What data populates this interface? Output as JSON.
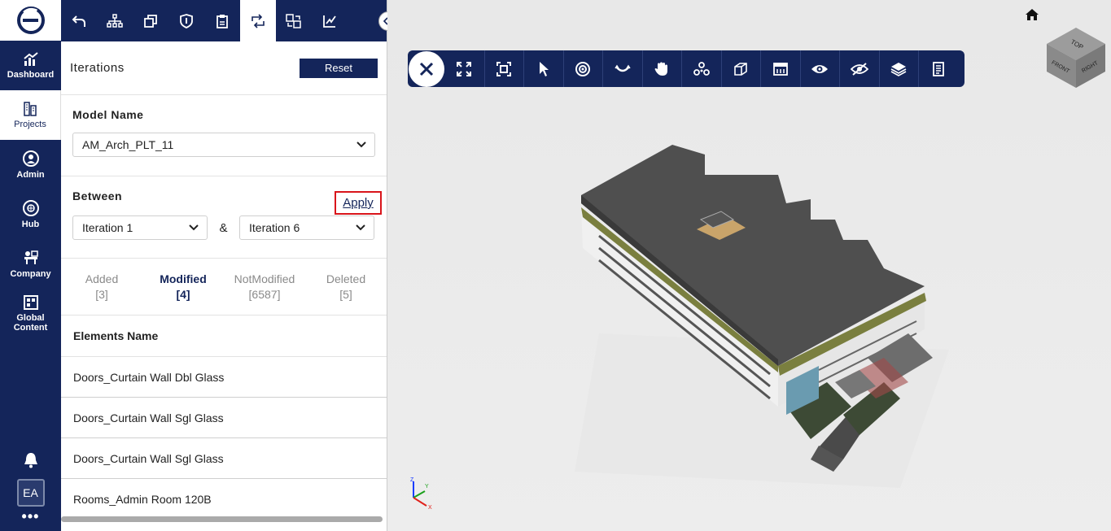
{
  "nav": {
    "items": [
      {
        "label": "Dashboard"
      },
      {
        "label": "Projects"
      },
      {
        "label": "Admin"
      },
      {
        "label": "Hub"
      },
      {
        "label": "Company"
      },
      {
        "label": "Global Content"
      }
    ],
    "avatar_initials": "EA",
    "more": "•••"
  },
  "panel": {
    "title": "Iterations",
    "reset_label": "Reset",
    "model_name_label": "Model Name",
    "model_name_value": "AM_Arch_PLT_11",
    "between_label": "Between",
    "apply_label": "Apply",
    "iteration_from": "Iteration 1",
    "ampersand": "&",
    "iteration_to": "Iteration 6",
    "stats": [
      {
        "label": "Added",
        "count": "[3]"
      },
      {
        "label": "Modified",
        "count": "[4]"
      },
      {
        "label": "NotModified",
        "count": "[6587]"
      },
      {
        "label": "Deleted",
        "count": "[5]"
      }
    ],
    "elements_header": "Elements Name",
    "elements": [
      "Doors_Curtain Wall Dbl Glass",
      "Doors_Curtain Wall Sgl Glass",
      "Doors_Curtain Wall Sgl Glass",
      "Rooms_Admin Room 120B"
    ]
  },
  "viewer": {
    "viewcube": {
      "top": "TOP",
      "front": "FRONT",
      "right": "RIGHT"
    },
    "axes": {
      "x": "X",
      "y": "Y",
      "z": "Z"
    }
  },
  "colors": {
    "navy": "#14255a",
    "highlight": "#d9151b"
  }
}
